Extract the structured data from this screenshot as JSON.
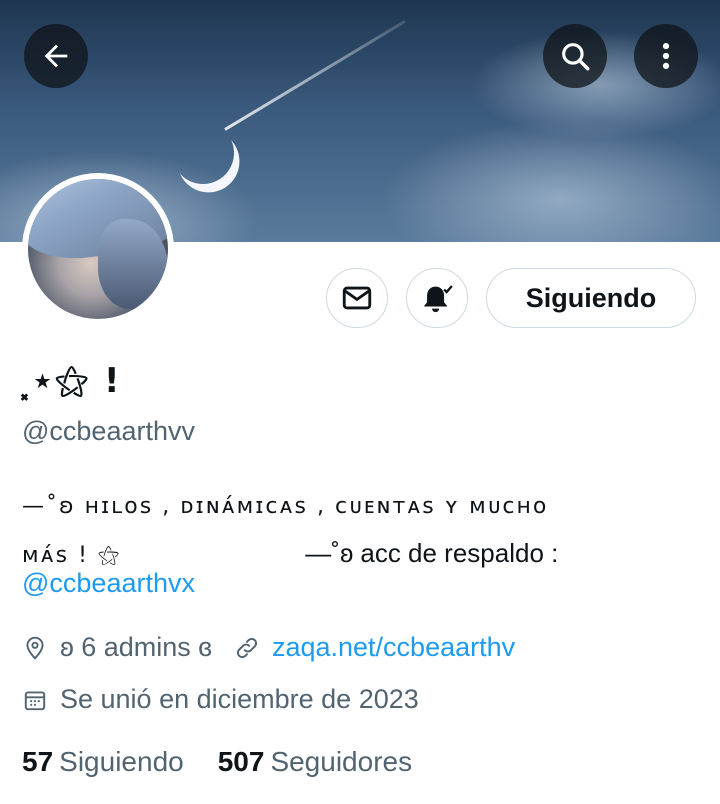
{
  "header": {
    "back_icon": "arrow-left-icon",
    "search_icon": "search-icon",
    "more_icon": "more-vertical-icon"
  },
  "actions": {
    "message_icon": "envelope-icon",
    "notify_icon": "bell-check-icon",
    "follow_label": "Siguiendo"
  },
  "profile": {
    "name": "⸼⋆⚝ !",
    "handle": "@ccbeaarthvv",
    "bio_line1": "—˚ʚ ʜɪʟᴏꜱ , ᴅɪɴᴀ́ᴍɪᴄᴀꜱ , ᴄᴜᴇɴᴛᴀꜱ ʏ ᴍᴜᴄʜᴏ",
    "bio_line2_a": "ᴍᴀ́ꜱ ! ⚝",
    "bio_line2_b": "—˚ʚ  acc de respaldo :",
    "bio_link": "@ccbeaarthvx",
    "location": "ʚ 6 admins ɞ",
    "website": "zaqa.net/ccbeaarthv",
    "joined": "Se unió en diciembre de 2023"
  },
  "stats": {
    "following_count": "57",
    "following_label": "Siguiendo",
    "followers_count": "507",
    "followers_label": "Seguidores"
  },
  "colors": {
    "accent": "#1d9bf0",
    "text": "#0f1419",
    "secondary": "#536471",
    "border": "#cfd9de"
  }
}
